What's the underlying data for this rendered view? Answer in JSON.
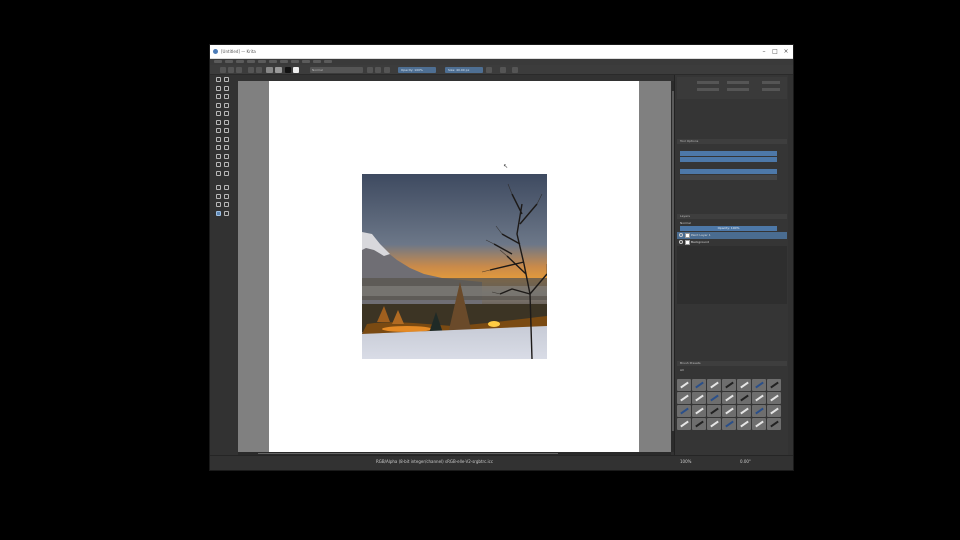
{
  "window": {
    "title": "[Untitled] — Krita",
    "controls": [
      "–",
      "□",
      "×"
    ]
  },
  "tool_options": {
    "blend_mode": "Normal",
    "opacity": "Opacity: 100%",
    "size": "Size: 40.00 px"
  },
  "toolbox": {
    "active_tool": "zoom-tool",
    "tools": [
      "cursor-icon",
      "text-icon",
      "crop-icon",
      "brush-icon",
      "pencil-icon",
      "line-icon",
      "rectangle-icon",
      "ellipse-icon",
      "polygon-icon",
      "polyline-icon",
      "bezier-icon",
      "freehand-path-icon",
      "calligraphy-icon",
      "transform-icon",
      "move-icon",
      "grid-icon",
      "perspective-icon",
      "fill-icon",
      "gradient-icon",
      "color-picker-icon",
      "smart-patch-icon",
      "assistant-icon",
      "measure-icon",
      "reference-icon",
      "rect-select-icon",
      "ellipse-select-icon",
      "poly-select-icon",
      "outline-select-icon",
      "contiguous-select-icon",
      "similar-select-icon",
      "zoom-icon",
      "pan-icon"
    ]
  },
  "canvas": {
    "image_description_ref": "sunset-landscape-photo"
  },
  "statusbar": {
    "text": "RGB/Alpha (8-bit integer/channel) sRGB-elle-V2-srgbtrc.icc",
    "zoom": "100%",
    "rotation": "0.00°"
  },
  "dock": {
    "tool_options_title": "Tool Options",
    "layers_title": "Layers",
    "opacity_label": "Opacity: 100%",
    "blending": "Normal",
    "layers": [
      {
        "name": "Paint Layer 1",
        "selected": true
      },
      {
        "name": "Background",
        "selected": false
      }
    ],
    "brush_presets_title": "Brush Presets",
    "brush_tag": "All"
  },
  "colors": {
    "accent": "#4d78a8",
    "panel": "#353535",
    "canvas_bg": "#808080"
  }
}
